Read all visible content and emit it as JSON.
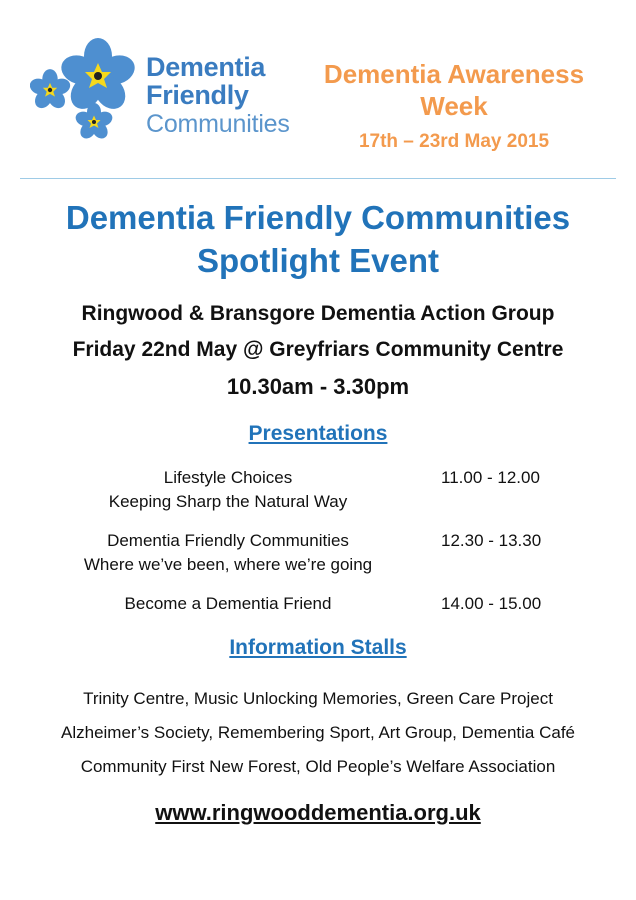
{
  "logo": {
    "line1": "Dementia",
    "line2": "Friendly",
    "line3": "Communities",
    "petal_color": "#4e8fd0",
    "center_color": "#f7d91c"
  },
  "awareness": {
    "title_line1": "Dementia Awareness",
    "title_line2": "Week",
    "dates": "17th – 23rd May 2015",
    "color": "#f39a4d"
  },
  "event": {
    "title_line1": "Dementia Friendly Communities",
    "title_line2": "Spotlight Event",
    "organizer": "Ringwood & Bransgore Dementia Action Group",
    "date_location": "Friday 22nd May @ Greyfriars Community Centre",
    "time": "10.30am - 3.30pm",
    "accent_color": "#2173b9"
  },
  "presentations": {
    "heading": "Presentations",
    "items": [
      {
        "title": "Lifestyle Choices",
        "subtitle": "Keeping Sharp the Natural Way",
        "time": "11.00 - 12.00"
      },
      {
        "title": "Dementia Friendly Communities",
        "subtitle": "Where we’ve been, where we’re going",
        "time": "12.30 - 13.30"
      },
      {
        "title": "Become a Dementia Friend",
        "subtitle": "",
        "time": "14.00 - 15.00"
      }
    ]
  },
  "stalls": {
    "heading": "Information Stalls",
    "lines": [
      "Trinity Centre, Music Unlocking Memories, Green Care Project",
      "Alzheimer’s Society, Remembering Sport, Art Group, Dementia Café",
      "Community First New Forest, Old People’s Welfare Association"
    ]
  },
  "website": "www.ringwooddementia.org.uk"
}
